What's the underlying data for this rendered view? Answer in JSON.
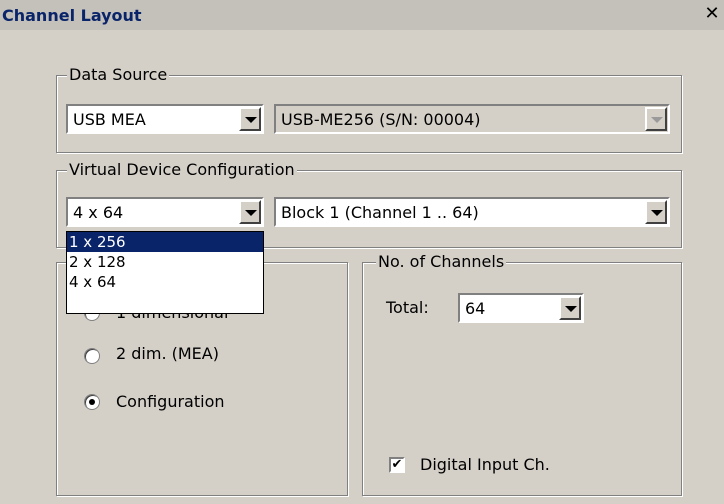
{
  "window": {
    "title": "Channel Layout",
    "close_glyph": "✕"
  },
  "data_source": {
    "legend": "Data Source",
    "source_select": "USB MEA",
    "device_select": "USB-ME256  (S/N: 00004)"
  },
  "virtual_device": {
    "legend": "Virtual Device Configuration",
    "config_select": "4 x 64",
    "block_select": "Block 1 (Channel 1 .. 64)",
    "dropdown_options": [
      {
        "label": "1 x 256",
        "selected": true
      },
      {
        "label": "2 x 128",
        "selected": false
      },
      {
        "label": "4 x 64",
        "selected": false
      }
    ]
  },
  "layout": {
    "radio_hidden_label": "1 dimensional",
    "radio_2dim_label": "2 dim. (MEA)",
    "radio_config_label": "Configuration",
    "selected": "Configuration"
  },
  "channels": {
    "legend": "No. of Channels",
    "total_label": "Total:",
    "total_value": "64",
    "digital_input_label": "Digital Input Ch.",
    "digital_input_checked": true
  }
}
